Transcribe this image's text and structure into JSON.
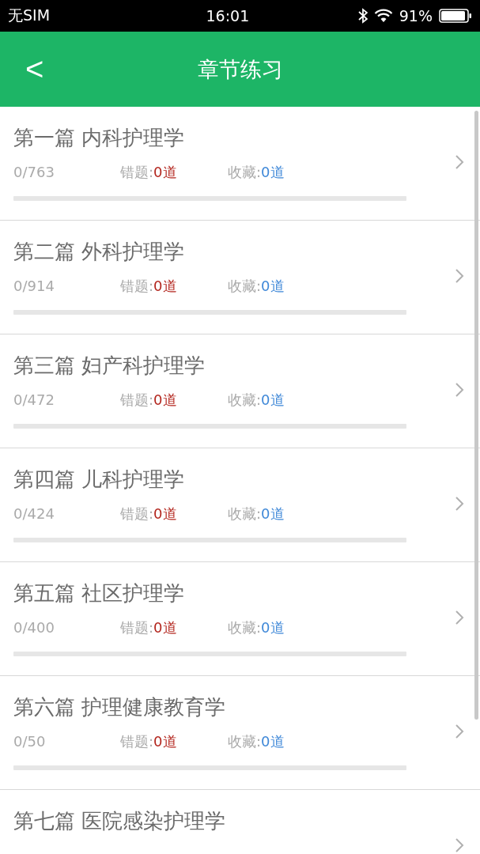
{
  "status_bar": {
    "carrier": "无SIM",
    "time": "16:01",
    "battery": "91%"
  },
  "header": {
    "back": "<",
    "title": "章节练习"
  },
  "chapters": [
    {
      "title": "第一篇 内科护理学",
      "progress": "0/763",
      "wrong_label": "错题:",
      "wrong_count": "0道",
      "fav_label": "收藏:",
      "fav_count": "0道",
      "level": 0
    },
    {
      "title": "第二篇 外科护理学",
      "progress": "0/914",
      "wrong_label": "错题:",
      "wrong_count": "0道",
      "fav_label": "收藏:",
      "fav_count": "0道",
      "level": 0
    },
    {
      "title": "第三篇 妇产科护理学",
      "progress": "0/472",
      "wrong_label": "错题:",
      "wrong_count": "0道",
      "fav_label": "收藏:",
      "fav_count": "0道",
      "level": 0
    },
    {
      "title": "第四篇 儿科护理学",
      "progress": "0/424",
      "wrong_label": "错题:",
      "wrong_count": "0道",
      "fav_label": "收藏:",
      "fav_count": "0道",
      "level": 0
    },
    {
      "title": "第五篇 社区护理学",
      "progress": "0/400",
      "wrong_label": "错题:",
      "wrong_count": "0道",
      "fav_label": "收藏:",
      "fav_count": "0道",
      "level": 0
    },
    {
      "title": "第六篇 护理健康教育学",
      "progress": "0/50",
      "wrong_label": "错题:",
      "wrong_count": "0道",
      "fav_label": "收藏:",
      "fav_count": "0道",
      "level": 0
    },
    {
      "title": "第七篇 医院感染护理学"
    }
  ]
}
